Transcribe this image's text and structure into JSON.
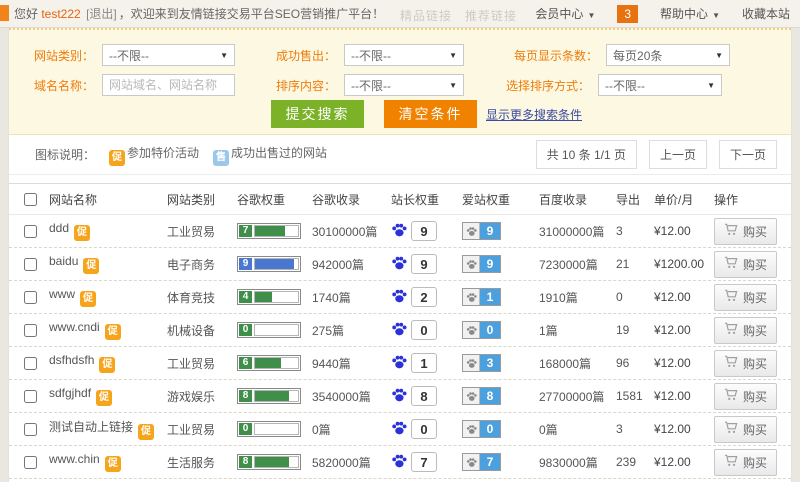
{
  "topbar": {
    "greeting_prefix": "您好 ",
    "username": "test222",
    "logout": "[退出]",
    "welcome": "，欢迎来到友情链接交易平台SEO营销推广平台！",
    "ghost_nav": "精品链接　推荐链接",
    "member_center": "会员中心",
    "badge_count": "3",
    "help_center": "帮助中心",
    "favorite": "收藏本站"
  },
  "filters": {
    "site_category": {
      "label": "网站类别：",
      "value": "--不限--"
    },
    "sold_status": {
      "label": "成功售出：",
      "value": "--不限--"
    },
    "per_page": {
      "label": "每页显示条数：",
      "value": "每页20条"
    },
    "domain_name": {
      "label": "域名名称：",
      "placeholder": "网站域名、网站名称"
    },
    "sort_content": {
      "label": "排序内容：",
      "value": "--不限--"
    },
    "sort_method": {
      "label": "选择排序方式：",
      "value": "--不限--"
    },
    "submit_label": "提交搜索",
    "clear_label": "清空条件",
    "more_label": "显示更多搜索条件"
  },
  "legend": {
    "label": "图标说明：",
    "promo_icon": "促",
    "promo_text": "参加特价活动",
    "sold_icon": "售",
    "sold_text": "成功出售过的网站",
    "total": "共 10 条 1/1 页",
    "prev": "上一页",
    "next": "下一页"
  },
  "colors": {
    "accent_orange": "#f08200",
    "accent_green": "#7cb228",
    "promo_badge": "#f7a41d",
    "sold_badge": "#9cc7e8",
    "pr_green": "#3f8f4a",
    "pr_blue": "#4a77d0",
    "baidu_paw_blue": "#2a32d8",
    "aizhan_blue": "#4ba0dd"
  },
  "table": {
    "headers": [
      "网站名称",
      "网站类别",
      "谷歌权重",
      "谷歌收录",
      "站长权重",
      "爱站权重",
      "百度收录",
      "导出",
      "单价/月",
      "操作"
    ],
    "buy_label": "购买",
    "rows": [
      {
        "name": "ddd",
        "category": "工业贸易",
        "pr": 7,
        "pr_color": "#3f8f4a",
        "google_index": "30100000篇",
        "bd_rank": "9",
        "az_rank": "9",
        "baidu_index": "31000000篇",
        "export": "3",
        "price": "¥12.00"
      },
      {
        "name": "baidu",
        "category": "电子商务",
        "pr": 9,
        "pr_color": "#4a77d0",
        "google_index": "942000篇",
        "bd_rank": "9",
        "az_rank": "9",
        "baidu_index": "7230000篇",
        "export": "21",
        "price": "¥1200.00"
      },
      {
        "name": "www",
        "category": "体育竞技",
        "pr": 4,
        "pr_color": "#3f8f4a",
        "google_index": "1740篇",
        "bd_rank": "2",
        "az_rank": "1",
        "baidu_index": "1910篇",
        "export": "0",
        "price": "¥12.00"
      },
      {
        "name": "www.cndi",
        "category": "机械设备",
        "pr": 0,
        "pr_color": "#3f8f4a",
        "google_index": "275篇",
        "bd_rank": "0",
        "az_rank": "0",
        "baidu_index": "1篇",
        "export": "19",
        "price": "¥12.00"
      },
      {
        "name": "dsfhdsfh",
        "category": "工业贸易",
        "pr": 6,
        "pr_color": "#3f8f4a",
        "google_index": "9440篇",
        "bd_rank": "1",
        "az_rank": "3",
        "baidu_index": "168000篇",
        "export": "96",
        "price": "¥12.00"
      },
      {
        "name": "sdfgjhdf",
        "category": "游戏娱乐",
        "pr": 8,
        "pr_color": "#3f8f4a",
        "google_index": "3540000篇",
        "bd_rank": "8",
        "az_rank": "8",
        "baidu_index": "27700000篇",
        "export": "1581",
        "price": "¥12.00"
      },
      {
        "name": "测试自动上链接",
        "category": "工业贸易",
        "pr": 0,
        "pr_color": "#3f8f4a",
        "google_index": "0篇",
        "bd_rank": "0",
        "az_rank": "0",
        "baidu_index": "0篇",
        "export": "3",
        "price": "¥12.00"
      },
      {
        "name": "www.chin",
        "category": "生活服务",
        "pr": 8,
        "pr_color": "#3f8f4a",
        "google_index": "5820000篇",
        "bd_rank": "7",
        "az_rank": "7",
        "baidu_index": "9830000篇",
        "export": "239",
        "price": "¥12.00"
      }
    ]
  }
}
